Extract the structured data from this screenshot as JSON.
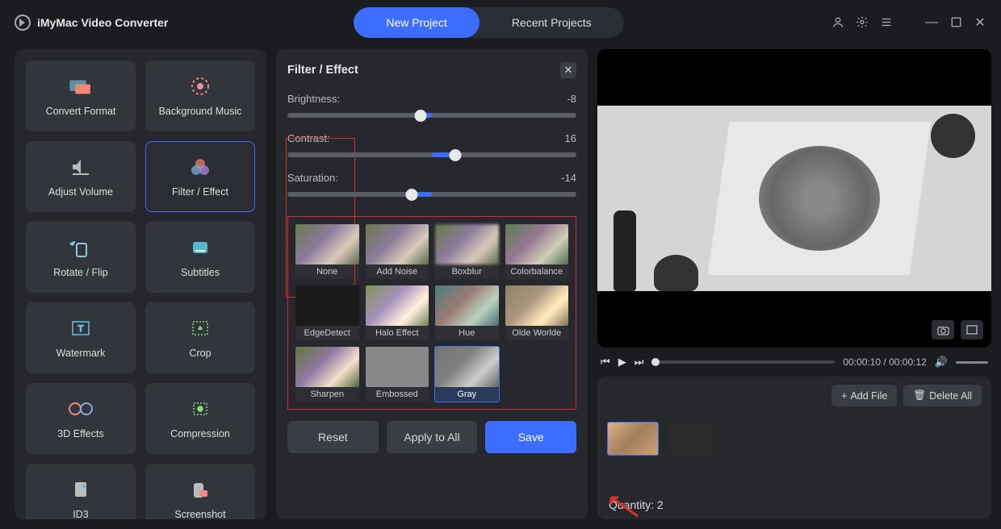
{
  "app": {
    "title": "iMyMac Video Converter"
  },
  "tabs": {
    "new": "New Project",
    "recent": "Recent Projects"
  },
  "sidebar": {
    "items": [
      {
        "label": "Convert Format"
      },
      {
        "label": "Background Music"
      },
      {
        "label": "Adjust Volume"
      },
      {
        "label": "Filter / Effect"
      },
      {
        "label": "Rotate / Flip"
      },
      {
        "label": "Subtitles"
      },
      {
        "label": "Watermark"
      },
      {
        "label": "Crop"
      },
      {
        "label": "3D Effects"
      },
      {
        "label": "Compression"
      },
      {
        "label": "ID3"
      },
      {
        "label": "Screenshot"
      }
    ]
  },
  "panel": {
    "title": "Filter / Effect",
    "sliders": {
      "brightness": {
        "label": "Brightness:",
        "value": "-8",
        "pos": 46
      },
      "contrast": {
        "label": "Contrast:",
        "value": "16",
        "pos": 58
      },
      "saturation": {
        "label": "Saturation:",
        "value": "-14",
        "pos": 43
      }
    },
    "filters": [
      "None",
      "Add Noise",
      "Boxblur",
      "Colorbalance",
      "EdgeDetect",
      "Halo Effect",
      "Hue",
      "Olde Worlde",
      "Sharpen",
      "Embossed",
      "Gray"
    ],
    "selected_filter": "Gray",
    "actions": {
      "reset": "Reset",
      "apply": "Apply to All",
      "save": "Save"
    }
  },
  "player": {
    "time_current": "00:00:10",
    "time_total": "00:00:12",
    "time_sep": " / "
  },
  "bottom": {
    "add": "Add File",
    "delete": "Delete All",
    "quantity_label": "Quantity: ",
    "quantity_value": "2"
  }
}
